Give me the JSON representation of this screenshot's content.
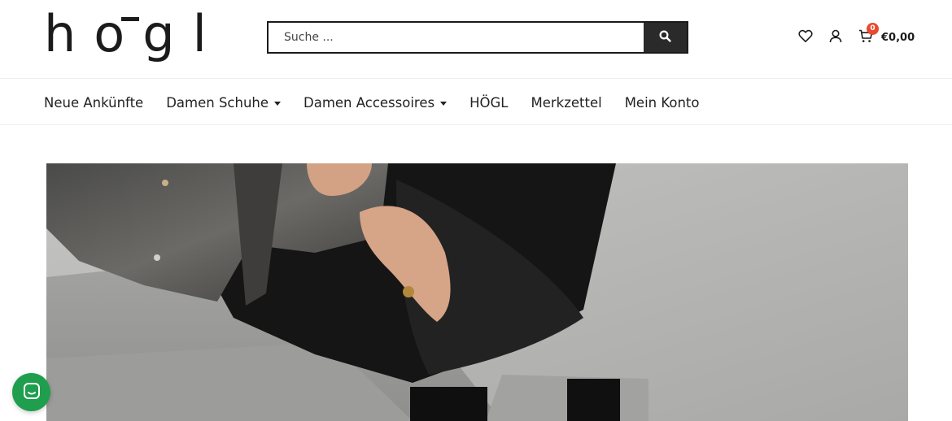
{
  "header": {
    "logo_text": "hōgl",
    "search": {
      "placeholder": "Suche ..."
    },
    "cart": {
      "count": "0",
      "total": "€0,00"
    }
  },
  "nav": {
    "items": [
      {
        "label": "Neue Ankünfte",
        "has_dropdown": false
      },
      {
        "label": "Damen Schuhe",
        "has_dropdown": true
      },
      {
        "label": "Damen Accessoires",
        "has_dropdown": true
      },
      {
        "label": "HÖGL",
        "has_dropdown": false
      },
      {
        "label": "Merkzettel",
        "has_dropdown": false
      },
      {
        "label": "Mein Konto",
        "has_dropdown": false
      }
    ]
  },
  "colors": {
    "primary": "#1b1b1b",
    "badge": "#e8492f",
    "chat": "#1f9e4e"
  },
  "icons": [
    "search-icon",
    "heart-icon",
    "user-icon",
    "cart-icon",
    "chat-icon",
    "chevron-down-icon"
  ]
}
